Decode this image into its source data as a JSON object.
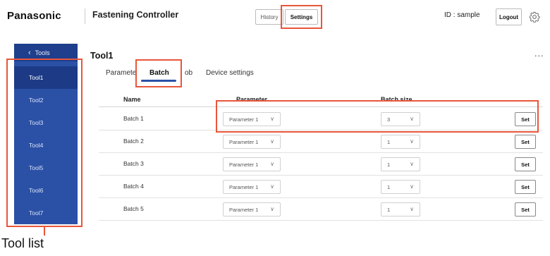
{
  "header": {
    "brand": "Panasonic",
    "app_title": "Fastening Controller",
    "history_label": "History",
    "settings_label": "Settings",
    "id_label": "ID : sample",
    "logout_label": "Logout",
    "settings_icon": "gear-icon"
  },
  "sidebar": {
    "back_label": "Tools",
    "items": [
      {
        "label": "Tool1",
        "active": true
      },
      {
        "label": "Tool2",
        "active": false
      },
      {
        "label": "Tool3",
        "active": false
      },
      {
        "label": "Tool4",
        "active": false
      },
      {
        "label": "Tool5",
        "active": false
      },
      {
        "label": "Tool6",
        "active": false
      },
      {
        "label": "Tool7",
        "active": false
      }
    ]
  },
  "main": {
    "title": "Tool1",
    "more_label": "...",
    "tabs": [
      {
        "label": "Parameter",
        "active": false
      },
      {
        "label": "Batch",
        "active": true
      },
      {
        "label": "ob",
        "active": false
      },
      {
        "label": "Device settings",
        "active": false
      }
    ],
    "table": {
      "headers": {
        "name": "Name",
        "parameter": "Parameter",
        "batch_size": "Batch size"
      },
      "rows": [
        {
          "name": "Batch 1",
          "parameter": "Parameter 1",
          "batch_size": "3",
          "action": "Set"
        },
        {
          "name": "Batch 2",
          "parameter": "Parameter 1",
          "batch_size": "1",
          "action": "Set"
        },
        {
          "name": "Batch 3",
          "parameter": "Parameter 1",
          "batch_size": "1",
          "action": "Set"
        },
        {
          "name": "Batch 4",
          "parameter": "Parameter 1",
          "batch_size": "1",
          "action": "Set"
        },
        {
          "name": "Batch 5",
          "parameter": "Parameter 1",
          "batch_size": "1",
          "action": "Set"
        }
      ]
    }
  },
  "annotation": {
    "callout_label": "Tool list",
    "highlight_color": "#e8563a"
  },
  "colors": {
    "sidebar_bg": "#2b51a6",
    "sidebar_active": "#1c3a86",
    "accent": "#2b51a6"
  }
}
